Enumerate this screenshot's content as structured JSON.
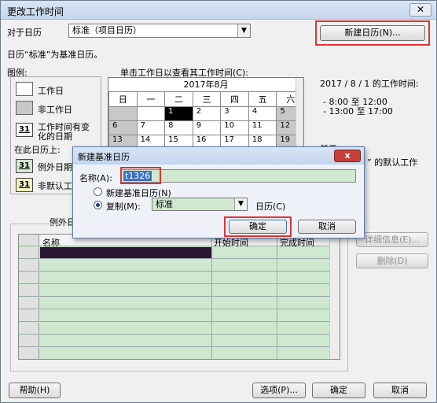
{
  "window": {
    "title": "更改工作时间",
    "close": "✕"
  },
  "for_calendar": {
    "label": "对于日历",
    "value": "标准（项目日历）"
  },
  "new_calendar_button": "新建日历(N)...",
  "base_note": "日历“标准”为基准日历。",
  "legend": {
    "title": "图例:",
    "working": "工作日",
    "nonworking": "非工作日",
    "edited_line1": "工作时间有变",
    "edited_line2": "化的日期",
    "on_this_calendar": "在此日历上:",
    "exception": "例外日期",
    "nondefault": "非默认工",
    "num": "31"
  },
  "calendar_hint": "单击工作日以查看其工作时间(C):",
  "calendar": {
    "month": "2017年8月",
    "weekdays": [
      "日",
      "一",
      "二",
      "三",
      "四",
      "五",
      "六"
    ],
    "weeks": [
      [
        "",
        "",
        "1",
        "2",
        "3",
        "4",
        "5"
      ],
      [
        "6",
        "7",
        "8",
        "9",
        "10",
        "11",
        "12"
      ],
      [
        "13",
        "14",
        "15",
        "16",
        "17",
        "18",
        "19"
      ]
    ]
  },
  "work_info": {
    "title": "2017 / 8 / 1 的工作时间:",
    "line1": "- 8:00 至 12:00",
    "line2": "- 13:00 至 17:00",
    "trail1": "基于",
    "trail2": "” 的默认工作"
  },
  "exceptions_tab": "例外日",
  "grid": {
    "col_name": "名称",
    "col_start": "开始时间",
    "col_end": "完成时间"
  },
  "side_buttons": {
    "details": "详细信息(E)...",
    "delete": "删除(D)"
  },
  "dialog": {
    "title": "新建基准日历",
    "close": "x",
    "name_label": "名称(A):",
    "name_value": "t1326",
    "opt_new": "新建基准日历(N)",
    "opt_copy": "复制(M):",
    "copy_value": "标准",
    "copy_suffix": "日历(C)",
    "ok": "确定",
    "cancel": "取消"
  },
  "bottom": {
    "help": "帮助(H)",
    "options": "选项(P)...",
    "ok": "确定",
    "cancel": "取消"
  },
  "colors": {
    "nonworking": "#c8c8c8",
    "exception": "#cfe8cf",
    "highlight": "#e53030"
  }
}
